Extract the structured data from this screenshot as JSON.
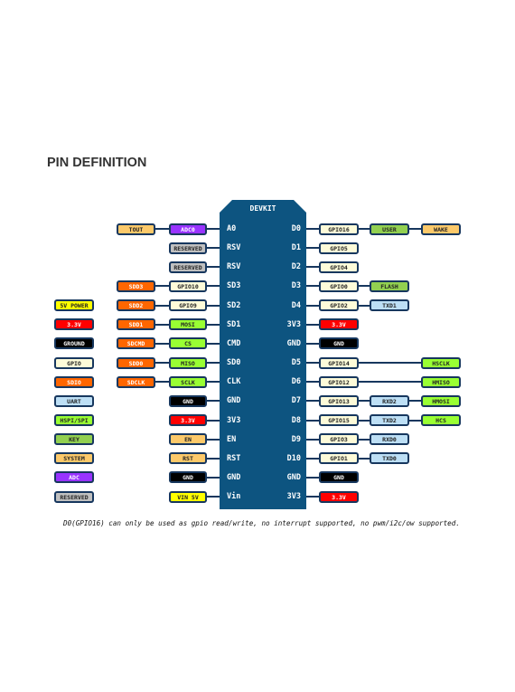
{
  "title": "PIN DEFINITION",
  "board_label": "DEVKIT",
  "footnote": "D0(GPIO16) can only be used as gpio read/write, no interrupt supported, no pwm/i2c/ow supported.",
  "colors": {
    "board": "#0d5480",
    "border": "#17375e",
    "system": "#fcc96a",
    "adc": "#9933ff",
    "reserved": "#c0c0c0",
    "sdio": "#ff6600",
    "gpio": "#fdfbd9",
    "hspi": "#99ff33",
    "key": "#92d050",
    "uart": "#bddff5",
    "power33": "#ff0000",
    "power5": "#ffff00",
    "ground": "#000000"
  },
  "legend": [
    {
      "text": "5V POWER",
      "type": "power5"
    },
    {
      "text": "3.3V",
      "type": "power33"
    },
    {
      "text": "GROUND",
      "type": "ground"
    },
    {
      "text": "GPIO",
      "type": "gpio"
    },
    {
      "text": "SDIO",
      "type": "sdio"
    },
    {
      "text": "UART",
      "type": "uart"
    },
    {
      "text": "HSPI/SPI",
      "type": "hspi"
    },
    {
      "text": "KEY",
      "type": "key"
    },
    {
      "text": "SYSTEM",
      "type": "system"
    },
    {
      "text": "ADC",
      "type": "adc"
    },
    {
      "text": "RESERVED",
      "type": "reserved"
    }
  ],
  "rows": [
    {
      "left_pin": "A0",
      "right_pin": "D0",
      "left": {
        "b": {
          "text": "ADC0",
          "type": "adc"
        },
        "a": {
          "text": "TOUT",
          "type": "system"
        }
      },
      "right": {
        "c": {
          "text": "GPIO16",
          "type": "gpio"
        },
        "d": {
          "text": "USER",
          "type": "key"
        },
        "e": {
          "text": "WAKE",
          "type": "system"
        }
      }
    },
    {
      "left_pin": "RSV",
      "right_pin": "D1",
      "left": {
        "b": {
          "text": "RESERVED",
          "type": "reserved"
        }
      },
      "right": {
        "c": {
          "text": "GPIO5",
          "type": "gpio"
        }
      }
    },
    {
      "left_pin": "RSV",
      "right_pin": "D2",
      "left": {
        "b": {
          "text": "RESERVED",
          "type": "reserved"
        }
      },
      "right": {
        "c": {
          "text": "GPIO4",
          "type": "gpio"
        }
      }
    },
    {
      "left_pin": "SD3",
      "right_pin": "D3",
      "left": {
        "b": {
          "text": "GPIO10",
          "type": "gpio"
        },
        "a": {
          "text": "SDD3",
          "type": "sdio"
        }
      },
      "right": {
        "c": {
          "text": "GPIO0",
          "type": "gpio"
        },
        "d": {
          "text": "FLASH",
          "type": "key"
        }
      }
    },
    {
      "left_pin": "SD2",
      "right_pin": "D4",
      "left": {
        "b": {
          "text": "GPIO9",
          "type": "gpio"
        },
        "a": {
          "text": "SDD2",
          "type": "sdio"
        }
      },
      "right": {
        "c": {
          "text": "GPIO2",
          "type": "gpio"
        },
        "d": {
          "text": "TXD1",
          "type": "uart"
        }
      }
    },
    {
      "left_pin": "SD1",
      "right_pin": "3V3",
      "left": {
        "b": {
          "text": "MOSI",
          "type": "hspi"
        },
        "a": {
          "text": "SDD1",
          "type": "sdio"
        }
      },
      "right": {
        "c": {
          "text": "3.3V",
          "type": "power33"
        }
      }
    },
    {
      "left_pin": "CMD",
      "right_pin": "GND",
      "left": {
        "b": {
          "text": "CS",
          "type": "hspi"
        },
        "a": {
          "text": "SDCMD",
          "type": "sdio"
        }
      },
      "right": {
        "c": {
          "text": "GND",
          "type": "ground"
        }
      }
    },
    {
      "left_pin": "SD0",
      "right_pin": "D5",
      "left": {
        "b": {
          "text": "MISO",
          "type": "hspi"
        },
        "a": {
          "text": "SDD0",
          "type": "sdio"
        }
      },
      "right": {
        "c": {
          "text": "GPIO14",
          "type": "gpio"
        },
        "e": {
          "text": "HSCLK",
          "type": "hspi"
        }
      }
    },
    {
      "left_pin": "CLK",
      "right_pin": "D6",
      "left": {
        "b": {
          "text": "SCLK",
          "type": "hspi"
        },
        "a": {
          "text": "SDCLK",
          "type": "sdio"
        }
      },
      "right": {
        "c": {
          "text": "GPIO12",
          "type": "gpio"
        },
        "e": {
          "text": "HMISO",
          "type": "hspi"
        }
      }
    },
    {
      "left_pin": "GND",
      "right_pin": "D7",
      "left": {
        "b": {
          "text": "GND",
          "type": "ground"
        }
      },
      "right": {
        "c": {
          "text": "GPIO13",
          "type": "gpio"
        },
        "d": {
          "text": "RXD2",
          "type": "uart"
        },
        "e": {
          "text": "HMOSI",
          "type": "hspi"
        }
      }
    },
    {
      "left_pin": "3V3",
      "right_pin": "D8",
      "left": {
        "b": {
          "text": "3.3V",
          "type": "power33"
        }
      },
      "right": {
        "c": {
          "text": "GPIO15",
          "type": "gpio"
        },
        "d": {
          "text": "TXD2",
          "type": "uart"
        },
        "e": {
          "text": "HCS",
          "type": "hspi"
        }
      }
    },
    {
      "left_pin": "EN",
      "right_pin": "D9",
      "left": {
        "b": {
          "text": "EN",
          "type": "system"
        }
      },
      "right": {
        "c": {
          "text": "GPIO3",
          "type": "gpio"
        },
        "d": {
          "text": "RXD0",
          "type": "uart"
        }
      }
    },
    {
      "left_pin": "RST",
      "right_pin": "D10",
      "left": {
        "b": {
          "text": "RST",
          "type": "system"
        }
      },
      "right": {
        "c": {
          "text": "GPIO1",
          "type": "gpio"
        },
        "d": {
          "text": "TXD0",
          "type": "uart"
        }
      }
    },
    {
      "left_pin": "GND",
      "right_pin": "GND",
      "left": {
        "b": {
          "text": "GND",
          "type": "ground"
        }
      },
      "right": {
        "c": {
          "text": "GND",
          "type": "ground"
        }
      }
    },
    {
      "left_pin": "Vin",
      "right_pin": "3V3",
      "left": {
        "b": {
          "text": "VIN 5V",
          "type": "power5"
        }
      },
      "right": {
        "c": {
          "text": "3.3V",
          "type": "power33"
        }
      }
    }
  ]
}
